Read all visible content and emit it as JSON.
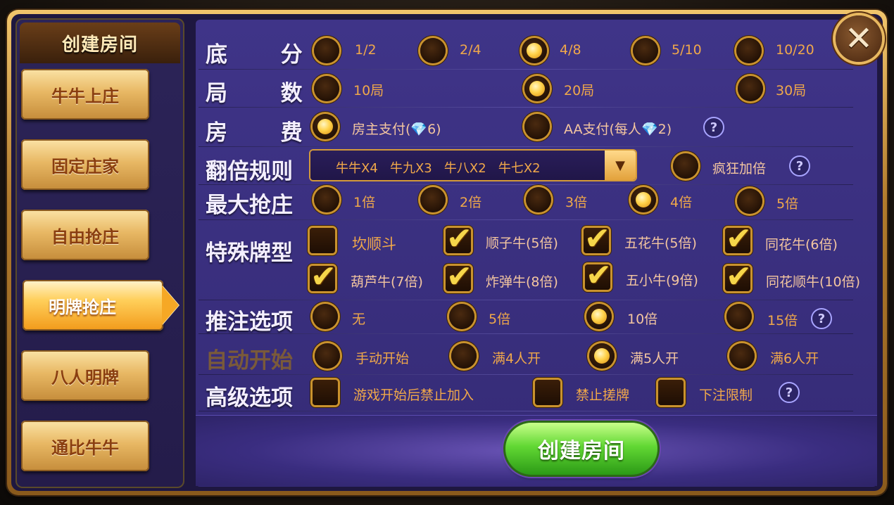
{
  "sidebar": {
    "title": "创建房间",
    "modes": [
      "牛牛上庄",
      "固定庄家",
      "自由抢庄",
      "明牌抢庄",
      "八人明牌",
      "通比牛牛"
    ],
    "active": "明牌抢庄"
  },
  "rows": {
    "base_score": {
      "label": "底  分",
      "options": [
        "1/2",
        "2/4",
        "4/8",
        "5/10",
        "10/20"
      ],
      "selected": "4/8"
    },
    "rounds": {
      "label": "局  数",
      "options": [
        "10局",
        "20局",
        "30局"
      ],
      "selected": "20局"
    },
    "room_fee": {
      "label": "房  费",
      "option1_prefix": "房主支付(",
      "option1_suffix": "6)",
      "option2_prefix": "AA支付(每人",
      "option2_suffix": "2)",
      "selected": "房主支付"
    },
    "multiplier_rule": {
      "label": "翻倍规则",
      "dropdown_value": "牛牛X4   牛九X3   牛八X2   牛七X2",
      "crazy_label": "疯狂加倍",
      "crazy_checked": false
    },
    "max_banker_bid": {
      "label": "最大抢庄",
      "options": [
        "1倍",
        "2倍",
        "3倍",
        "4倍",
        "5倍"
      ],
      "selected": "4倍"
    },
    "special_hands": {
      "label": "特殊牌型",
      "items": [
        {
          "label": "坎顺斗",
          "checked": false
        },
        {
          "label": "顺子牛(5倍)",
          "checked": true
        },
        {
          "label": "五花牛(5倍)",
          "checked": true
        },
        {
          "label": "同花牛(6倍)",
          "checked": true
        },
        {
          "label": "葫芦牛(7倍)",
          "checked": true
        },
        {
          "label": "炸弹牛(8倍)",
          "checked": true
        },
        {
          "label": "五小牛(9倍)",
          "checked": true
        },
        {
          "label": "同花顺牛(10倍)",
          "checked": true
        }
      ]
    },
    "push_bet": {
      "label": "推注选项",
      "options": [
        "无",
        "5倍",
        "10倍",
        "15倍"
      ],
      "selected": "10倍"
    },
    "auto_start": {
      "label": "自动开始",
      "options": [
        "手动开始",
        "满4人开",
        "满5人开",
        "满6人开"
      ],
      "selected": "满5人开"
    },
    "advanced": {
      "label": "高级选项",
      "options": [
        "游戏开始后禁止加入",
        "禁止搓牌",
        "下注限制"
      ]
    }
  },
  "create_button": "创建房间",
  "icons": {
    "close": "close-icon",
    "help": "help-icon",
    "gem": "diamond-icon",
    "dropdown": "chevron-down-icon"
  },
  "colors": {
    "panel": "#3f3488",
    "option_text": "#f0a84a",
    "gold": "#c9922e",
    "green_button": "#62d834"
  }
}
